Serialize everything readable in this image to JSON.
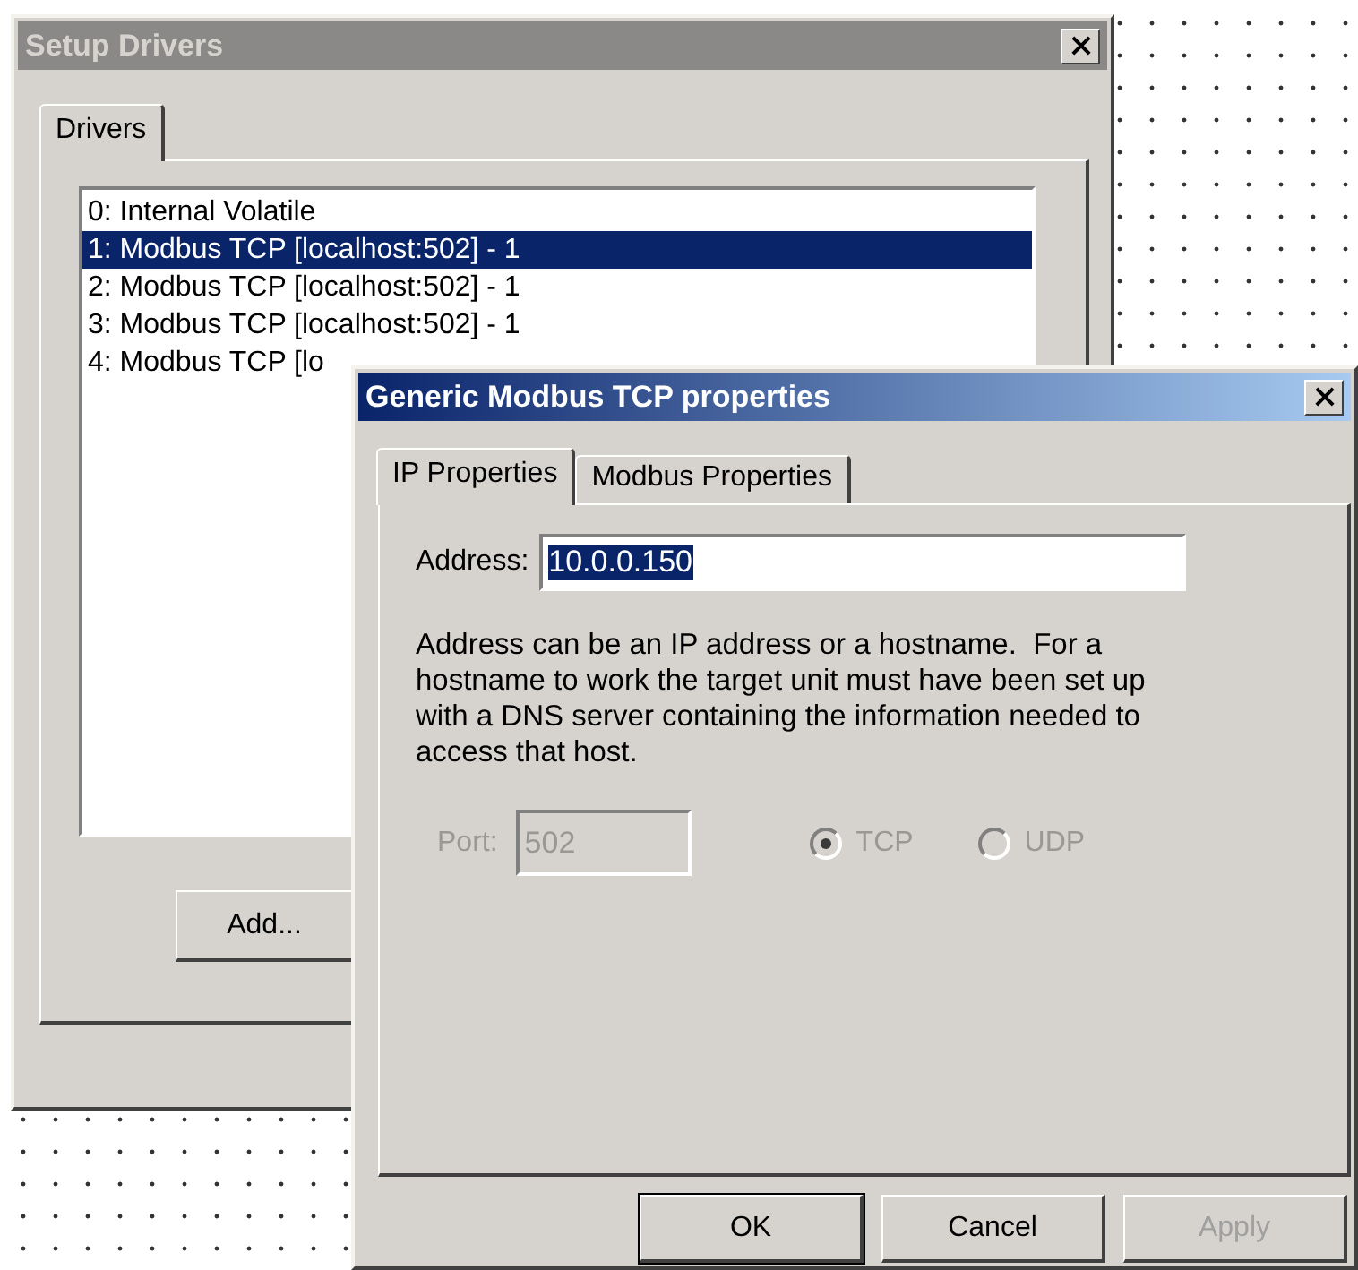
{
  "setup_drivers": {
    "title": "Setup Drivers",
    "active": false,
    "tabs": [
      {
        "label": "Drivers",
        "selected": true
      }
    ],
    "list": [
      {
        "text": "0: Internal Volatile",
        "selected": false
      },
      {
        "text": "1: Modbus TCP [localhost:502] - 1",
        "selected": true
      },
      {
        "text": "2: Modbus TCP [localhost:502] - 1",
        "selected": false
      },
      {
        "text": "3: Modbus TCP [localhost:502] - 1",
        "selected": false
      },
      {
        "text": "4: Modbus TCP [lo",
        "selected": false
      }
    ],
    "buttons": [
      {
        "label": "Add...",
        "disabled": false,
        "default": false
      }
    ]
  },
  "modbus_dialog": {
    "title": "Generic Modbus TCP properties",
    "active": true,
    "tabs": [
      {
        "label": "IP Properties",
        "selected": true
      },
      {
        "label": "Modbus Properties",
        "selected": false
      }
    ],
    "address": {
      "label": "Address:",
      "value": "10.0.0.150",
      "value_selected": true
    },
    "help": "Address can be an IP address or a hostname.  For a hostname to work the target unit must have been set up with a DNS server containing the information needed to access that host.",
    "port": {
      "label": "Port:",
      "value": "502",
      "disabled": true
    },
    "protocols": [
      {
        "label": "TCP",
        "selected": true,
        "disabled": true
      },
      {
        "label": "UDP",
        "selected": false,
        "disabled": true
      }
    ],
    "buttons": [
      {
        "label": "OK",
        "disabled": false,
        "default": true
      },
      {
        "label": "Cancel",
        "disabled": false,
        "default": false
      },
      {
        "label": "Apply",
        "disabled": true,
        "default": false
      }
    ]
  }
}
